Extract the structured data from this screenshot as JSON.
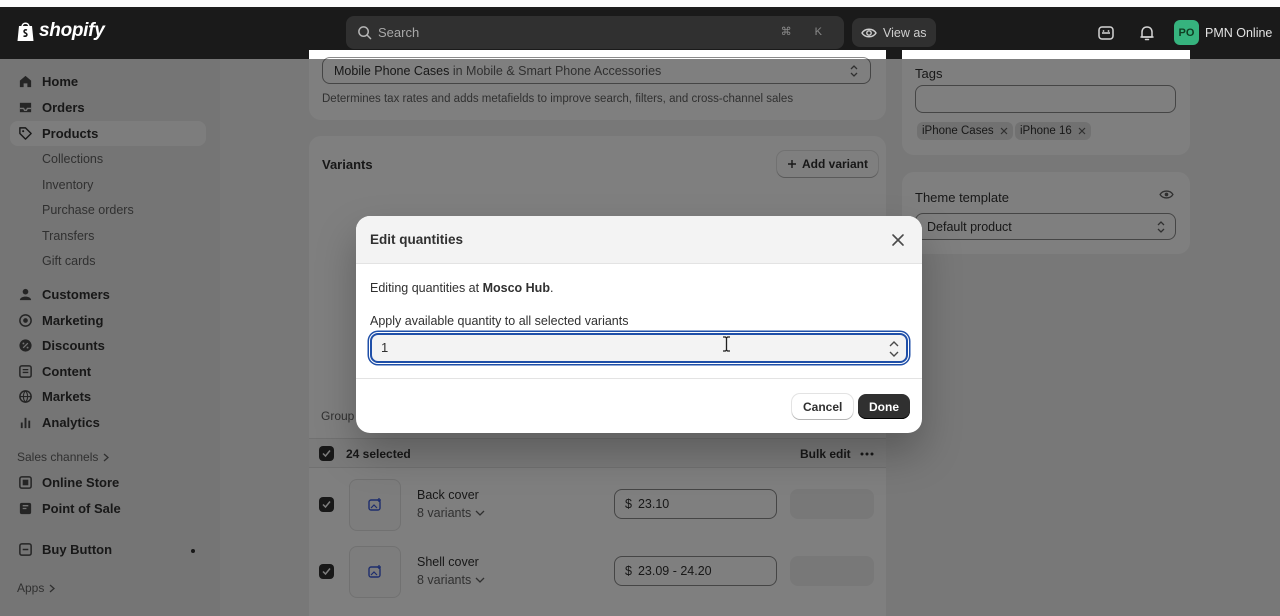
{
  "topbar": {
    "logo_text": "shopify",
    "search_placeholder": "Search",
    "search_shortcut": "⌘ K",
    "view_as": "View as",
    "avatar_initials": "PO",
    "store_name": "PMN Online"
  },
  "sidebar": {
    "items": [
      {
        "label": "Home"
      },
      {
        "label": "Orders"
      },
      {
        "label": "Products"
      },
      {
        "label": "Customers"
      },
      {
        "label": "Marketing"
      },
      {
        "label": "Discounts"
      },
      {
        "label": "Content"
      },
      {
        "label": "Markets"
      },
      {
        "label": "Analytics"
      }
    ],
    "product_subitems": [
      "Collections",
      "Inventory",
      "Purchase orders",
      "Transfers",
      "Gift cards"
    ],
    "sales_channels_label": "Sales channels",
    "channels": [
      "Online Store",
      "Point of Sale"
    ],
    "buy_button": "Buy Button",
    "apps_label": "Apps"
  },
  "category": {
    "value": "Mobile Phone Cases",
    "context": "in Mobile & Smart Phone Accessories",
    "helper": "Determines tax rates and adds metafields to improve search, filters, and cross-channel sales"
  },
  "variants": {
    "title": "Variants",
    "add_variant": "Add variant",
    "group_label": "Group",
    "selected_count": "24 selected",
    "bulk_edit": "Bulk edit",
    "rows": [
      {
        "title": "Back cover",
        "sub": "8 variants",
        "currency": "$",
        "price": "23.10"
      },
      {
        "title": "Shell cover",
        "sub": "8 variants",
        "currency": "$",
        "price": "23.09 - 24.20"
      }
    ]
  },
  "tags": {
    "title": "Tags",
    "items": [
      "iPhone Cases",
      "iPhone 16"
    ]
  },
  "theme": {
    "title": "Theme template",
    "value": "Default product"
  },
  "modal": {
    "title": "Edit quantities",
    "text_prefix": "Editing quantities at",
    "location": "Mosco Hub",
    "text_suffix": ".",
    "label": "Apply available quantity to all selected variants",
    "quantity": "1",
    "cancel": "Cancel",
    "done": "Done"
  }
}
